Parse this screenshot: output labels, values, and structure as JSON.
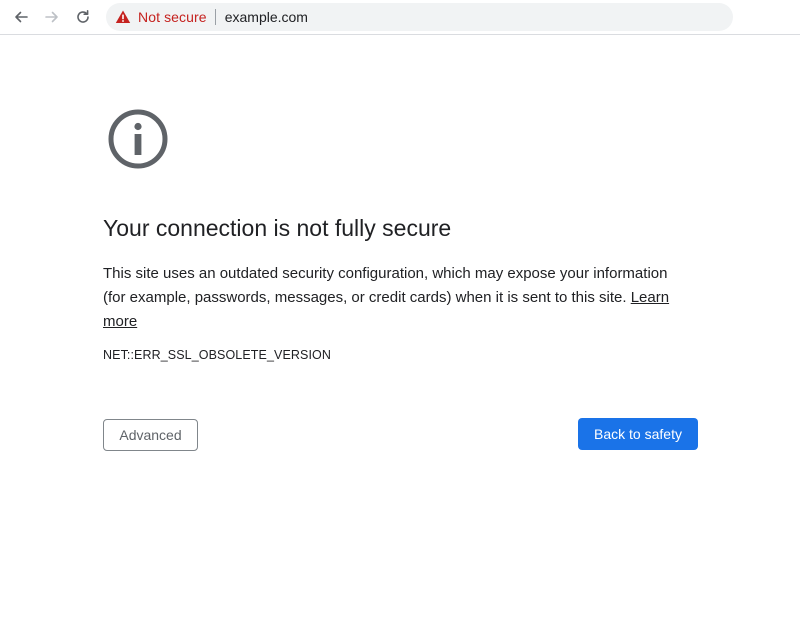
{
  "browser": {
    "security_chip": {
      "label": "Not secure",
      "icon": "warning-triangle-icon",
      "color": "#c5221f"
    },
    "url": "example.com",
    "nav": {
      "back_icon": "arrow-left-icon",
      "forward_icon": "arrow-right-icon",
      "reload_icon": "reload-icon"
    }
  },
  "interstitial": {
    "icon": "info-circle-icon",
    "heading": "Your connection is not fully secure",
    "body": "This site uses an outdated security configuration, which may expose your information (for example, passwords, messages, or credit cards) when it is sent to this site.",
    "learn_more": "Learn more",
    "error_code": "NET::ERR_SSL_OBSOLETE_VERSION",
    "advanced_label": "Advanced",
    "back_label": "Back to safety",
    "accent_color": "#1a73e8"
  }
}
